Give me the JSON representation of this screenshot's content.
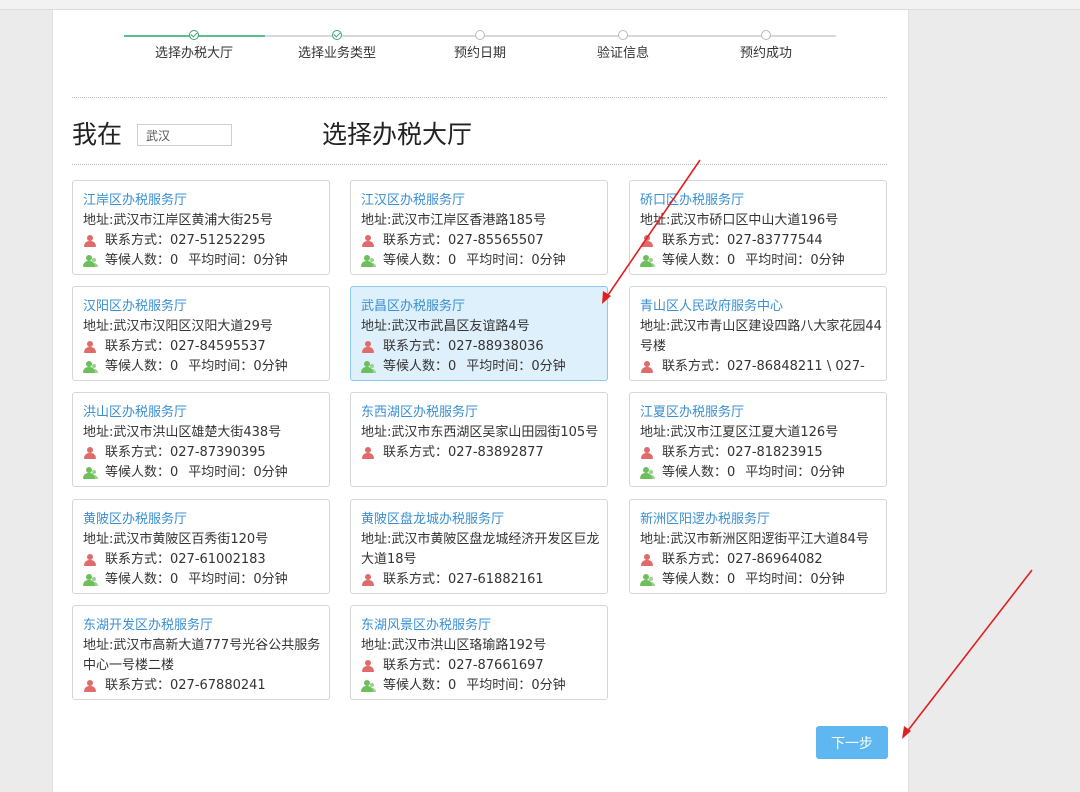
{
  "steps": [
    {
      "label": "选择办税大厅",
      "done": true
    },
    {
      "label": "选择业务类型",
      "done": true
    },
    {
      "label": "预约日期",
      "done": false
    },
    {
      "label": "验证信息",
      "done": false
    },
    {
      "label": "预约成功",
      "done": false
    }
  ],
  "location": {
    "label": "我在",
    "city": "武汉"
  },
  "page_title": "选择办税大厅",
  "labels": {
    "phone": "联系方式：",
    "queue": "等候人数：",
    "avg_time": "平均时间："
  },
  "halls": [
    {
      "name": "江岸区办税服务厅",
      "address": "地址:武汉市江岸区黄浦大街25号",
      "phone": "027-51252295",
      "queue": "0",
      "avg": "0分钟",
      "selected": false
    },
    {
      "name": "江汉区办税服务厅",
      "address": "地址:武汉市江岸区香港路185号",
      "phone": "027-85565507",
      "queue": "0",
      "avg": "0分钟",
      "selected": false
    },
    {
      "name": "硚口区办税服务厅",
      "address": "地址:武汉市硚口区中山大道196号",
      "phone": "027-83777544",
      "queue": "0",
      "avg": "0分钟",
      "selected": false
    },
    {
      "name": "汉阳区办税服务厅",
      "address": "地址:武汉市汉阳区汉阳大道29号",
      "phone": "027-84595537",
      "queue": "0",
      "avg": "0分钟",
      "selected": false
    },
    {
      "name": "武昌区办税服务厅",
      "address": "地址:武汉市武昌区友谊路4号",
      "phone": "027-88938036",
      "queue": "0",
      "avg": "0分钟",
      "selected": true
    },
    {
      "name": "青山区人民政府服务中心",
      "address": "地址:武汉市青山区建设四路八大家花园44号楼",
      "phone": "027-86848211 \\ 027-",
      "queue": "",
      "avg": "",
      "selected": false
    },
    {
      "name": "洪山区办税服务厅",
      "address": "地址:武汉市洪山区雄楚大街438号",
      "phone": "027-87390395",
      "queue": "0",
      "avg": "0分钟",
      "selected": false
    },
    {
      "name": "东西湖区办税服务厅",
      "address": "地址:武汉市东西湖区吴家山田园街105号",
      "phone": "027-83892877",
      "queue": "",
      "avg": "",
      "selected": false
    },
    {
      "name": "江夏区办税服务厅",
      "address": "地址:武汉市江夏区江夏大道126号",
      "phone": "027-81823915",
      "queue": "0",
      "avg": "0分钟",
      "selected": false
    },
    {
      "name": "黄陂区办税服务厅",
      "address": "地址:武汉市黄陂区百秀街120号",
      "phone": "027-61002183",
      "queue": "0",
      "avg": "0分钟",
      "selected": false
    },
    {
      "name": "黄陂区盘龙城办税服务厅",
      "address": "地址:武汉市黄陂区盘龙城经济开发区巨龙大道18号",
      "phone": "027-61882161",
      "queue": "",
      "avg": "",
      "selected": false
    },
    {
      "name": "新洲区阳逻办税服务厅",
      "address": "地址:武汉市新洲区阳逻街平江大道84号",
      "phone": "027-86964082",
      "queue": "0",
      "avg": "0分钟",
      "selected": false
    },
    {
      "name": "东湖开发区办税服务厅",
      "address": "地址:武汉市高新大道777号光谷公共服务中心一号楼二楼",
      "phone": "027-67880241",
      "queue": "",
      "avg": "",
      "selected": false
    },
    {
      "name": "东湖风景区办税服务厅",
      "address": "地址:武汉市洪山区珞瑜路192号",
      "phone": "027-87661697",
      "queue": "0",
      "avg": "0分钟",
      "selected": false
    }
  ],
  "next_button": "下一步",
  "colors": {
    "accent": "#3a8fd2",
    "selected_bg": "#def0fb",
    "step_done": "#3aa56c",
    "button": "#5eb7f0",
    "annotation_arrow": "#e02020"
  }
}
